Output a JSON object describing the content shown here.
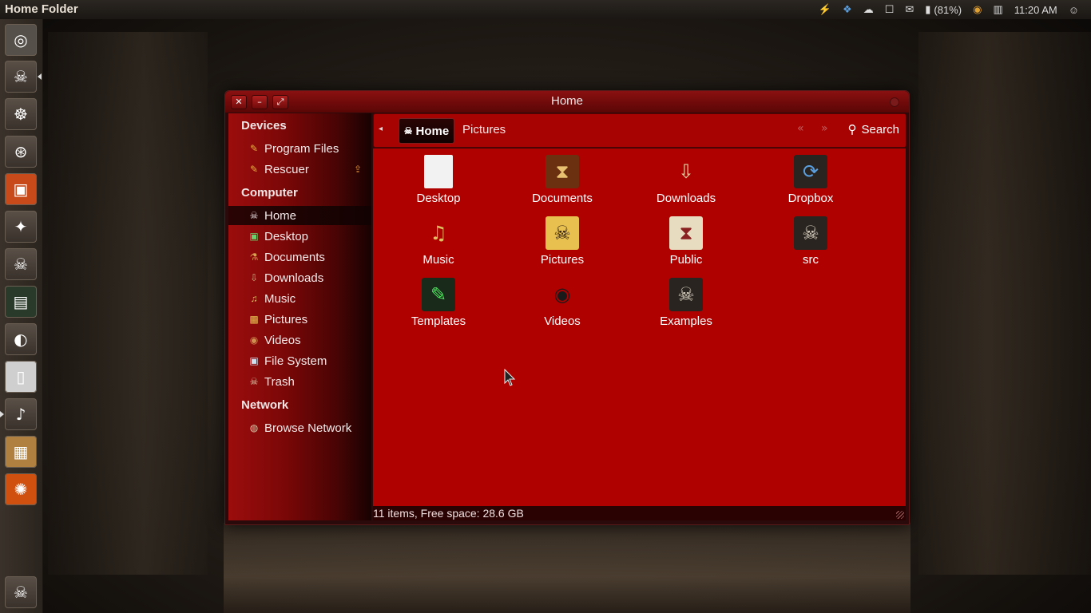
{
  "panel": {
    "title": "Home Folder",
    "battery": "(81%)",
    "clock": "11:20 AM"
  },
  "window": {
    "title": "Home"
  },
  "sidebar": {
    "devices_header": "Devices",
    "devices": [
      {
        "label": "Program Files"
      },
      {
        "label": "Rescuer"
      }
    ],
    "computer_header": "Computer",
    "computer": [
      {
        "label": "Home"
      },
      {
        "label": "Desktop"
      },
      {
        "label": "Documents"
      },
      {
        "label": "Downloads"
      },
      {
        "label": "Music"
      },
      {
        "label": "Pictures"
      },
      {
        "label": "Videos"
      },
      {
        "label": "File System"
      },
      {
        "label": "Trash"
      }
    ],
    "network_header": "Network",
    "network": [
      {
        "label": "Browse Network"
      }
    ]
  },
  "toolbar": {
    "crumb_home": "Home",
    "crumb_next": "Pictures",
    "search_label": "Search"
  },
  "files": [
    {
      "label": "Desktop"
    },
    {
      "label": "Documents"
    },
    {
      "label": "Downloads"
    },
    {
      "label": "Dropbox"
    },
    {
      "label": "Music"
    },
    {
      "label": "Pictures"
    },
    {
      "label": "Public"
    },
    {
      "label": "src"
    },
    {
      "label": "Templates"
    },
    {
      "label": "Videos"
    },
    {
      "label": "Examples"
    }
  ],
  "status": {
    "text": "11 items, Free space: 28.6 GB"
  }
}
